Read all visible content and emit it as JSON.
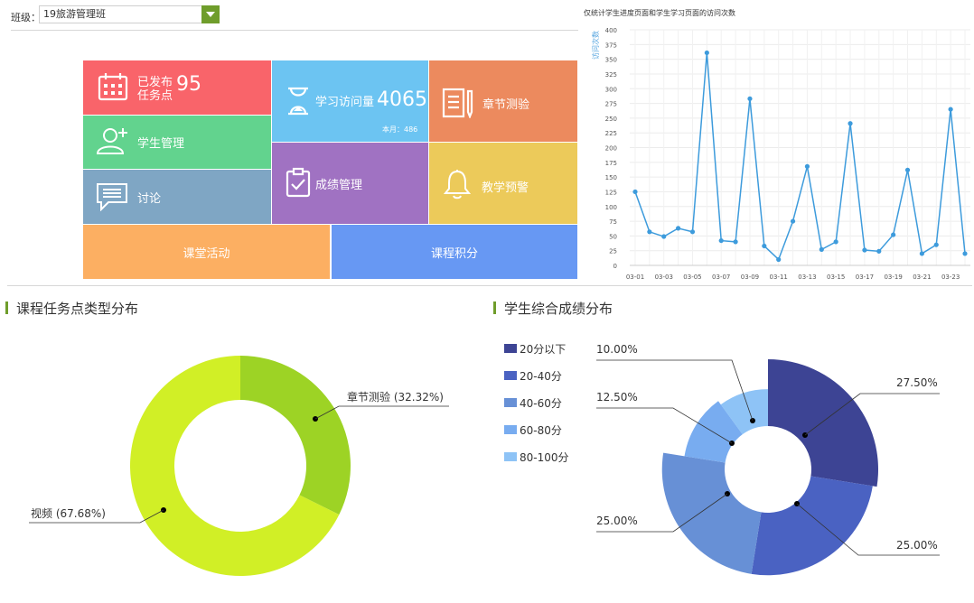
{
  "filter": {
    "label": "班级：",
    "selected": "19旅游管理班"
  },
  "tiles": {
    "tasks": {
      "label_line1": "已发布",
      "label_line2": "任务点",
      "count": "95",
      "color": "#f9646a"
    },
    "visits": {
      "label": "学习访问量",
      "count": "4065",
      "sub": "本月：486",
      "color": "#6cc4f2"
    },
    "quiz": {
      "label": "章节测验",
      "color": "#ec8a5e"
    },
    "students": {
      "label": "学生管理",
      "color": "#62d38e"
    },
    "grades": {
      "label": "成绩管理",
      "color": "#a072c2"
    },
    "discussion": {
      "label": "讨论",
      "color": "#7fa6c4"
    },
    "warning": {
      "label": "教学预警",
      "color": "#ecca5a"
    },
    "activity": {
      "label": "课堂活动",
      "color": "#fcaf62"
    },
    "points": {
      "label": "课程积分",
      "color": "#6798f3"
    }
  },
  "icons": {
    "tasks": "calendar-icon",
    "visits": "hourglass-icon",
    "quiz": "document-pen-icon",
    "students": "user-add-icon",
    "grades": "clipboard-check-icon",
    "discussion": "chat-icon",
    "warning": "bell-icon"
  },
  "sections": {
    "task_types": "课程任务点类型分布",
    "grade_dist": "学生综合成绩分布"
  },
  "chart_data": [
    {
      "type": "line",
      "title": "仅统计学生进度页面和学生学习页面的访问次数",
      "ylabel": "访问次数",
      "ylim": [
        0,
        400
      ],
      "yticks": [
        0,
        25,
        50,
        75,
        100,
        125,
        150,
        175,
        200,
        225,
        250,
        275,
        300,
        325,
        350,
        375,
        400
      ],
      "x": [
        "03-01",
        "03-02",
        "03-03",
        "03-04",
        "03-05",
        "03-06",
        "03-07",
        "03-08",
        "03-09",
        "03-10",
        "03-11",
        "03-12",
        "03-13",
        "03-14",
        "03-15",
        "03-16",
        "03-17",
        "03-18",
        "03-19",
        "03-20",
        "03-21",
        "03-22",
        "03-23",
        "03-24"
      ],
      "xtick_labels": [
        "03-01",
        "03-03",
        "03-05",
        "03-07",
        "03-09",
        "03-11",
        "03-13",
        "03-15",
        "03-17",
        "03-19",
        "03-21",
        "03-23"
      ],
      "values": [
        125,
        57,
        49,
        63,
        57,
        361,
        42,
        40,
        283,
        33,
        10,
        75,
        168,
        27,
        40,
        241,
        26,
        24,
        52,
        162,
        20,
        35,
        265,
        20
      ],
      "color": "#3d9bdc",
      "grid": true
    },
    {
      "type": "pie",
      "variant": "donut",
      "labels": [
        "章节测验",
        "视频"
      ],
      "values": [
        32.32,
        67.68
      ],
      "display": [
        "章节测验 (32.32%)",
        "视频 (67.68%)"
      ],
      "colors": [
        "#9dd325",
        "#d1ef26"
      ]
    },
    {
      "type": "pie",
      "variant": "rose-donut",
      "legend": [
        "20分以下",
        "20-40分",
        "40-60分",
        "60-80分",
        "80-100分"
      ],
      "values": [
        27.5,
        25.0,
        25.0,
        12.5,
        10.0
      ],
      "display": [
        "27.50%",
        "25.00%",
        "25.00%",
        "12.50%",
        "10.00%"
      ],
      "colors": [
        "#3d4494",
        "#4a62c2",
        "#6790d6",
        "#78acf0",
        "#8ec3f6"
      ],
      "legend_position": "left"
    }
  ]
}
